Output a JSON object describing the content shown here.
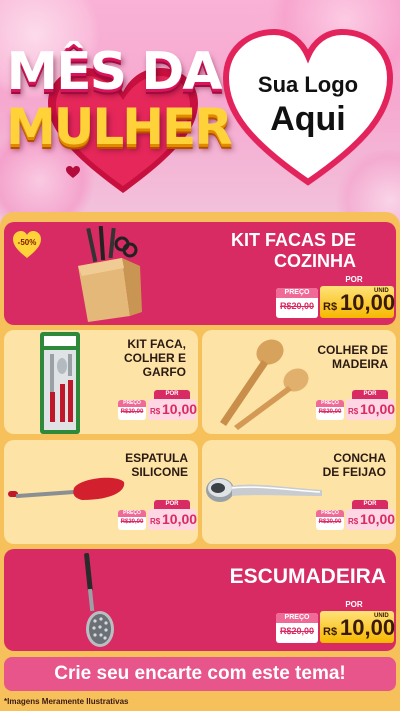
{
  "header": {
    "title_line1": "MÊS DA",
    "title_line2": "MULHER",
    "logo_line1": "Sua Logo",
    "logo_line2": "Aqui"
  },
  "discount_badge": "-50%",
  "products": [
    {
      "name_lines": [
        "KIT FACAS DE",
        "COZINHA"
      ],
      "image": "knife-block-icon",
      "old_label": "PREÇO",
      "old_price": "R$20,00",
      "por": "POR",
      "currency": "R$",
      "price": "10,00",
      "unit": "UNID"
    },
    {
      "name_lines": [
        "KIT FACA,",
        "COLHER E",
        "GARFO"
      ],
      "image": "cutlery-set-icon",
      "old_label": "PREÇO",
      "old_price": "R$20,00",
      "por": "POR",
      "currency": "R$",
      "price": "10,00",
      "unit": ""
    },
    {
      "name_lines": [
        "COLHER DE",
        "MADEIRA"
      ],
      "image": "wooden-spoon-icon",
      "old_label": "PREÇO",
      "old_price": "R$20,00",
      "por": "POR",
      "currency": "R$",
      "price": "10,00",
      "unit": ""
    },
    {
      "name_lines": [
        "ESPATULA",
        "SILICONE"
      ],
      "image": "spatula-icon",
      "old_label": "PREÇO",
      "old_price": "R$20,00",
      "por": "POR",
      "currency": "R$",
      "price": "10,00",
      "unit": ""
    },
    {
      "name_lines": [
        "CONCHA",
        "DE FEIJAO"
      ],
      "image": "ladle-icon",
      "old_label": "PREÇO",
      "old_price": "R$20,00",
      "por": "POR",
      "currency": "R$",
      "price": "10,00",
      "unit": ""
    },
    {
      "name_lines": [
        "ESCUMADEIRA"
      ],
      "image": "skimmer-icon",
      "old_label": "PREÇO",
      "old_price": "R$20,00",
      "por": "POR",
      "currency": "R$",
      "price": "10,00",
      "unit": "UNID"
    }
  ],
  "cta": "Crie seu encarte com este tema!",
  "footer_note": "*Imagens Meramente Ilustrativas",
  "colors": {
    "pink": "#d92b63",
    "cream": "#fde3a6",
    "gold": "#f6c15a",
    "accent": "#ffd23a"
  }
}
